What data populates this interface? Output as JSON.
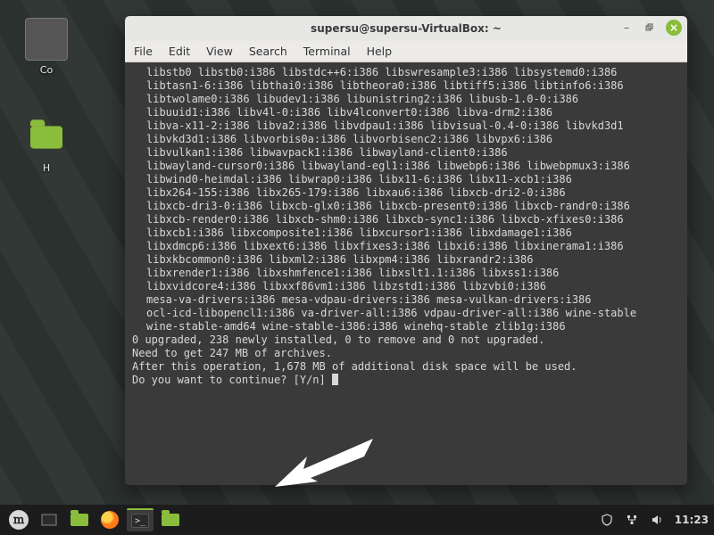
{
  "desktop": {
    "icons": [
      {
        "label": "Co",
        "kind": "computer"
      },
      {
        "label": "H",
        "kind": "home"
      }
    ]
  },
  "window": {
    "title": "supersu@supersu-VirtualBox: ~",
    "menu": [
      "File",
      "Edit",
      "View",
      "Search",
      "Terminal",
      "Help"
    ]
  },
  "terminal": {
    "packages": [
      "libstb0 libstb0:i386 libstdc++6:i386 libswresample3:i386 libsystemd0:i386",
      "libtasn1-6:i386 libthai0:i386 libtheora0:i386 libtiff5:i386 libtinfo6:i386",
      "libtwolame0:i386 libudev1:i386 libunistring2:i386 libusb-1.0-0:i386",
      "libuuid1:i386 libv4l-0:i386 libv4lconvert0:i386 libva-drm2:i386",
      "libva-x11-2:i386 libva2:i386 libvdpau1:i386 libvisual-0.4-0:i386 libvkd3d1",
      "libvkd3d1:i386 libvorbis0a:i386 libvorbisenc2:i386 libvpx6:i386",
      "libvulkan1:i386 libwavpack1:i386 libwayland-client0:i386",
      "libwayland-cursor0:i386 libwayland-egl1:i386 libwebp6:i386 libwebpmux3:i386",
      "libwind0-heimdal:i386 libwrap0:i386 libx11-6:i386 libx11-xcb1:i386",
      "libx264-155:i386 libx265-179:i386 libxau6:i386 libxcb-dri2-0:i386",
      "libxcb-dri3-0:i386 libxcb-glx0:i386 libxcb-present0:i386 libxcb-randr0:i386",
      "libxcb-render0:i386 libxcb-shm0:i386 libxcb-sync1:i386 libxcb-xfixes0:i386",
      "libxcb1:i386 libxcomposite1:i386 libxcursor1:i386 libxdamage1:i386",
      "libxdmcp6:i386 libxext6:i386 libxfixes3:i386 libxi6:i386 libxinerama1:i386",
      "libxkbcommon0:i386 libxml2:i386 libxpm4:i386 libxrandr2:i386",
      "libxrender1:i386 libxshmfence1:i386 libxslt1.1:i386 libxss1:i386",
      "libxvidcore4:i386 libxxf86vm1:i386 libzstd1:i386 libzvbi0:i386",
      "mesa-va-drivers:i386 mesa-vdpau-drivers:i386 mesa-vulkan-drivers:i386",
      "ocl-icd-libopencl1:i386 va-driver-all:i386 vdpau-driver-all:i386 wine-stable",
      "wine-stable-amd64 wine-stable-i386:i386 winehq-stable zlib1g:i386"
    ],
    "summary": [
      "0 upgraded, 238 newly installed, 0 to remove and 0 not upgraded.",
      "Need to get 247 MB of archives.",
      "After this operation, 1,678 MB of additional disk space will be used.",
      "Do you want to continue? [Y/n] "
    ]
  },
  "taskbar": {
    "clock": "11:23"
  }
}
